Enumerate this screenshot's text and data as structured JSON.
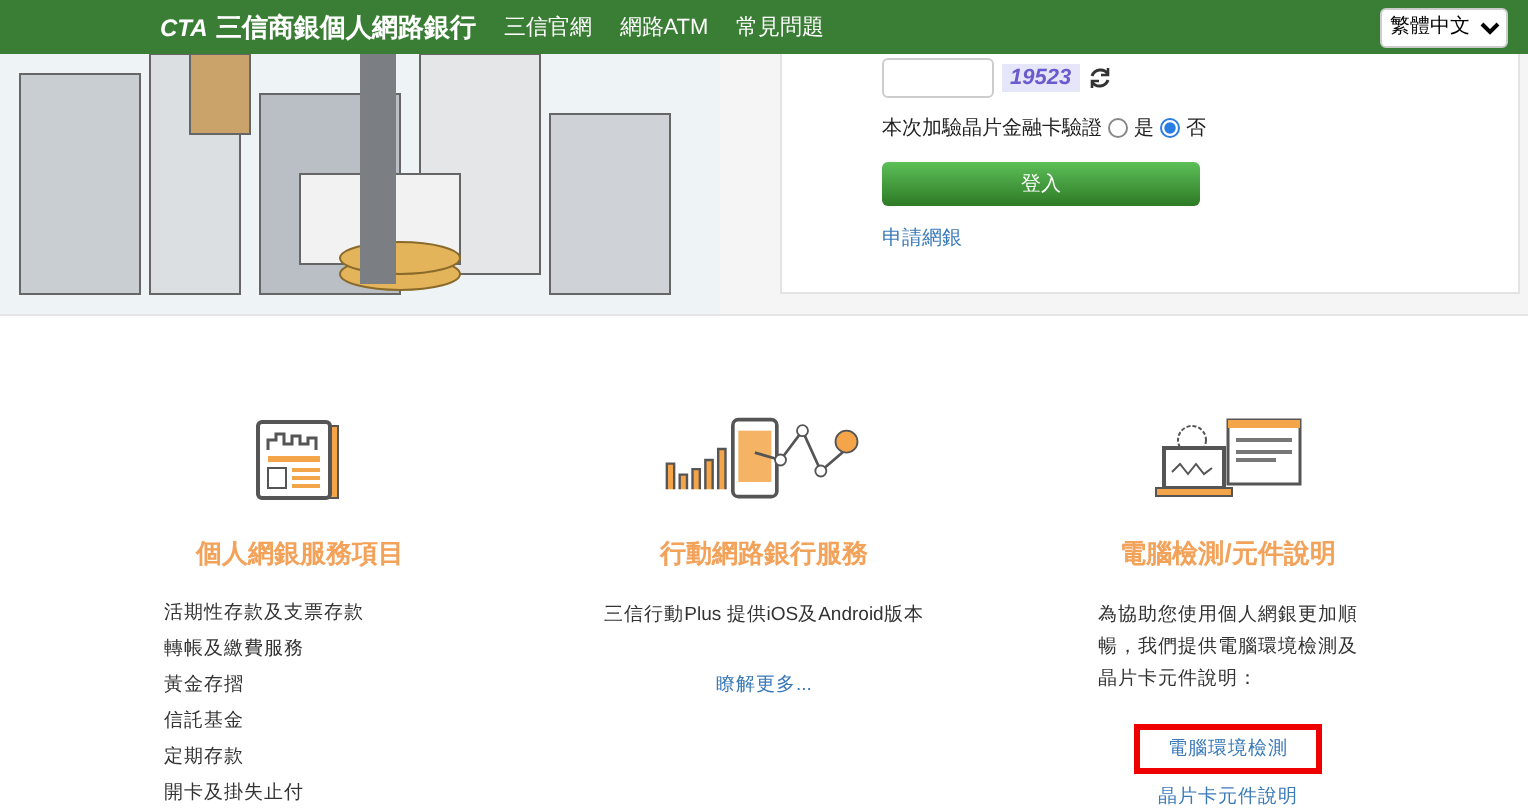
{
  "header": {
    "logo_text": "CTA",
    "title": "三信商銀個人網路銀行",
    "nav": [
      {
        "label": "三信官網"
      },
      {
        "label": "網路ATM"
      },
      {
        "label": "常見問題"
      }
    ],
    "language": "繁體中文"
  },
  "login": {
    "captcha": "19523",
    "chip_card_label": "本次加驗晶片金融卡驗證",
    "options": [
      {
        "label": "是",
        "selected": false
      },
      {
        "label": "否",
        "selected": true
      }
    ],
    "login_button": "登入",
    "apply_link": "申請網銀"
  },
  "sections": [
    {
      "kind": "list",
      "title": "個人網銀服務項目",
      "items": [
        "活期性存款及支票存款",
        "轉帳及繳費服務",
        "黃金存摺",
        "信託基金",
        "定期存款",
        "開卡及掛失止付"
      ]
    },
    {
      "kind": "mobile",
      "title": "行動網路銀行服務",
      "text": "三信行動Plus 提供iOS及Android版本",
      "links": [
        {
          "label": "瞭解更多...",
          "highlighted": false
        }
      ]
    },
    {
      "kind": "computer",
      "title": "電腦檢測/元件說明",
      "text": "為協助您使用個人網銀更加順暢，我們提供電腦環境檢測及晶片卡元件說明：",
      "links": [
        {
          "label": "電腦環境檢測",
          "highlighted": true
        },
        {
          "label": "晶片卡元件說明",
          "highlighted": false
        }
      ]
    }
  ]
}
